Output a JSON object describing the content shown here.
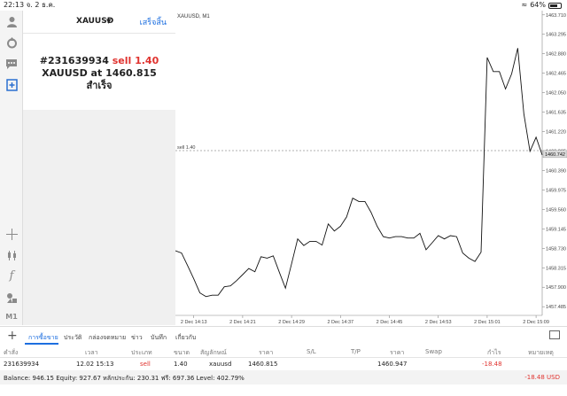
{
  "status_bar": {
    "time": "22:13",
    "date": "จ. 2 ธ.ค.",
    "battery": "64%",
    "battery_level": 0.64
  },
  "left_panel": {
    "symbol": "XAUUSD",
    "done_label": "เสร็จสิ้น",
    "order_line": "#231639934",
    "order_type": "sell 1.40",
    "price_line": "XAUUSD at 1460.815",
    "status": "สำเร็จ"
  },
  "side_tools": [
    {
      "icon": "person-icon"
    },
    {
      "icon": "gear-arrow-icon"
    },
    {
      "icon": "chat-icon"
    },
    {
      "icon": "add-doc-icon",
      "active": true
    },
    {
      "icon": "crosshair-icon"
    },
    {
      "icon": "candles-icon"
    },
    {
      "icon": "function-icon"
    },
    {
      "icon": "objects-icon"
    },
    {
      "icon": "timeframe-label",
      "text": "M1"
    }
  ],
  "chart": {
    "header": "XAUUSD, M1",
    "sell_label": "sell 1.40",
    "sell_price": 1460.815,
    "current_price_label": "1460.742",
    "current_price": 1460.742,
    "bg_color": "#ffffff",
    "line_color": "#111111",
    "price_ticks": [
      "1463.710",
      "1463.295",
      "1462.880",
      "1462.465",
      "1462.050",
      "1461.635",
      "1461.220",
      "1460.805",
      "1460.390",
      "1459.975",
      "1459.560",
      "1459.145",
      "1458.730",
      "1458.315",
      "1457.900",
      "1457.485"
    ],
    "time_ticks": [
      "2 Dec 14:13",
      "2 Dec 14:21",
      "2 Dec 14:29",
      "2 Dec 14:37",
      "2 Dec 14:45",
      "2 Dec 14:53",
      "2 Dec 15:01",
      "2 Dec 15:09"
    ]
  },
  "chart_data": {
    "type": "line",
    "title": "XAUUSD, M1",
    "xlabel": "",
    "ylabel": "",
    "ylim": [
      1457.3,
      1463.8
    ],
    "x": [
      "14:10",
      "14:11",
      "14:12",
      "14:13",
      "14:14",
      "14:15",
      "14:16",
      "14:17",
      "14:18",
      "14:19",
      "14:20",
      "14:21",
      "14:22",
      "14:23",
      "14:24",
      "14:25",
      "14:26",
      "14:27",
      "14:28",
      "14:29",
      "14:30",
      "14:31",
      "14:32",
      "14:33",
      "14:34",
      "14:35",
      "14:36",
      "14:37",
      "14:38",
      "14:39",
      "14:40",
      "14:41",
      "14:42",
      "14:43",
      "14:44",
      "14:45",
      "14:46",
      "14:47",
      "14:48",
      "14:49",
      "14:50",
      "14:51",
      "14:52",
      "14:53",
      "14:54",
      "14:55",
      "14:56",
      "14:57",
      "14:58",
      "14:59",
      "15:00",
      "15:01",
      "15:02",
      "15:03",
      "15:04",
      "15:05",
      "15:06",
      "15:07",
      "15:08",
      "15:09",
      "15:10"
    ],
    "values": [
      1458.68,
      1458.63,
      1458.36,
      1458.08,
      1457.78,
      1457.7,
      1457.73,
      1457.73,
      1457.91,
      1457.93,
      1458.04,
      1458.17,
      1458.3,
      1458.23,
      1458.55,
      1458.52,
      1458.57,
      1458.22,
      1457.88,
      1458.4,
      1458.93,
      1458.79,
      1458.88,
      1458.88,
      1458.8,
      1459.25,
      1459.1,
      1459.2,
      1459.4,
      1459.8,
      1459.73,
      1459.73,
      1459.5,
      1459.2,
      1458.98,
      1458.95,
      1458.98,
      1458.98,
      1458.95,
      1458.95,
      1459.05,
      1458.7,
      1458.85,
      1459.0,
      1458.93,
      1459.0,
      1458.98,
      1458.63,
      1458.52,
      1458.45,
      1458.65,
      1462.8,
      1462.5,
      1462.5,
      1462.13,
      1462.45,
      1463.0,
      1461.6,
      1460.8,
      1461.1,
      1460.72
    ]
  },
  "bottom_tabs": [
    {
      "label": "การซื้อขาย",
      "active": true
    },
    {
      "label": "ประวัติ"
    },
    {
      "label": "กล่องจดหมาย"
    },
    {
      "label": "ข่าว"
    },
    {
      "label": "บันทึก"
    },
    {
      "label": "เกี่ยวกับ"
    }
  ],
  "table": {
    "headers": [
      "คำสั่ง",
      "เวลา",
      "ประเภท",
      "ขนาด",
      "สัญลักษณ์",
      "ราคา",
      "S/L",
      "T/P",
      "ราคา",
      "Swap",
      "กำไร",
      "หมายเหตุ"
    ],
    "row": [
      "231639934",
      "12.02 15:13",
      "sell",
      "1.40",
      "xauusd",
      "1460.815",
      "",
      "",
      "1460.947",
      "",
      "-18.48",
      ""
    ]
  },
  "balance": {
    "text": "Balance: 946.15 Equity: 927.67 หลักประกัน: 230.31 ฟรี: 697.36 Level: 402.79%",
    "profit": "-18.48  USD"
  }
}
